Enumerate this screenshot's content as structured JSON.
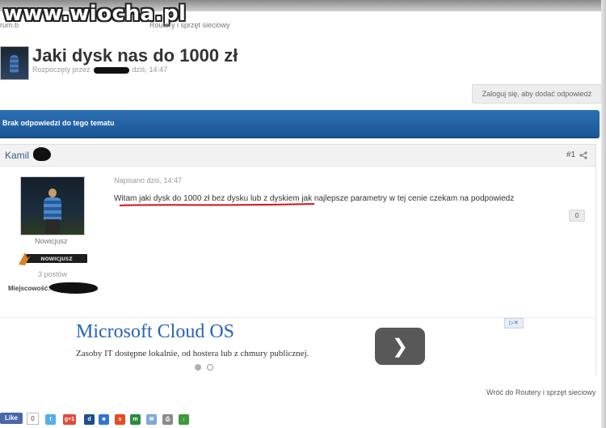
{
  "watermark": "www.wiocha.pl",
  "breadcrumb": {
    "left": "rum.b",
    "right": "Routery i sprzęt sieciowy"
  },
  "topic": {
    "title": "Jaki dysk nas do 1000 zł",
    "started_prefix": "Rozpoczęty przez",
    "started_time": "dziś, 14:47"
  },
  "login_button": "Zaloguj się, aby dodać odpowiedź",
  "no_replies": "Brak odpowiedzi do tego tematu",
  "post": {
    "author": "Kamil",
    "number": "#1",
    "written": "Napisano dziś, 14:47",
    "content": "Witam jaki dysk do 1000 zł bez dysku lub z dyskiem jak najlepsze parametry w tej cenie czekam na podpowiedz",
    "reputation": "0",
    "rank": "Nowicjusz",
    "rank_badge": "NOWICJUSZ",
    "posts_count": "3 postów",
    "location_label": "Miejscowość:"
  },
  "ad": {
    "title": "Microsoft Cloud OS",
    "text": "Zasoby IT dostępne lokalnie, od hostera lub z chmury publicznej.",
    "button_icon": "chevron-right-icon",
    "choices_icon": "adchoices-icon"
  },
  "back_link": "Wróć do Routery i sprzęt sieciowy",
  "social": {
    "like_label": "Like",
    "like_count": "0",
    "gplus_label": "g+1",
    "icons": [
      "twitter-icon",
      "google-plus-icon",
      "digg-icon",
      "delicious-icon",
      "stumbleupon-icon",
      "myspace-icon",
      "email-icon",
      "print-icon",
      "download-icon"
    ]
  },
  "colors": {
    "accent_blue": "#1d5796",
    "link_blue": "#355b8a",
    "ad_blue": "#2a64b8"
  }
}
